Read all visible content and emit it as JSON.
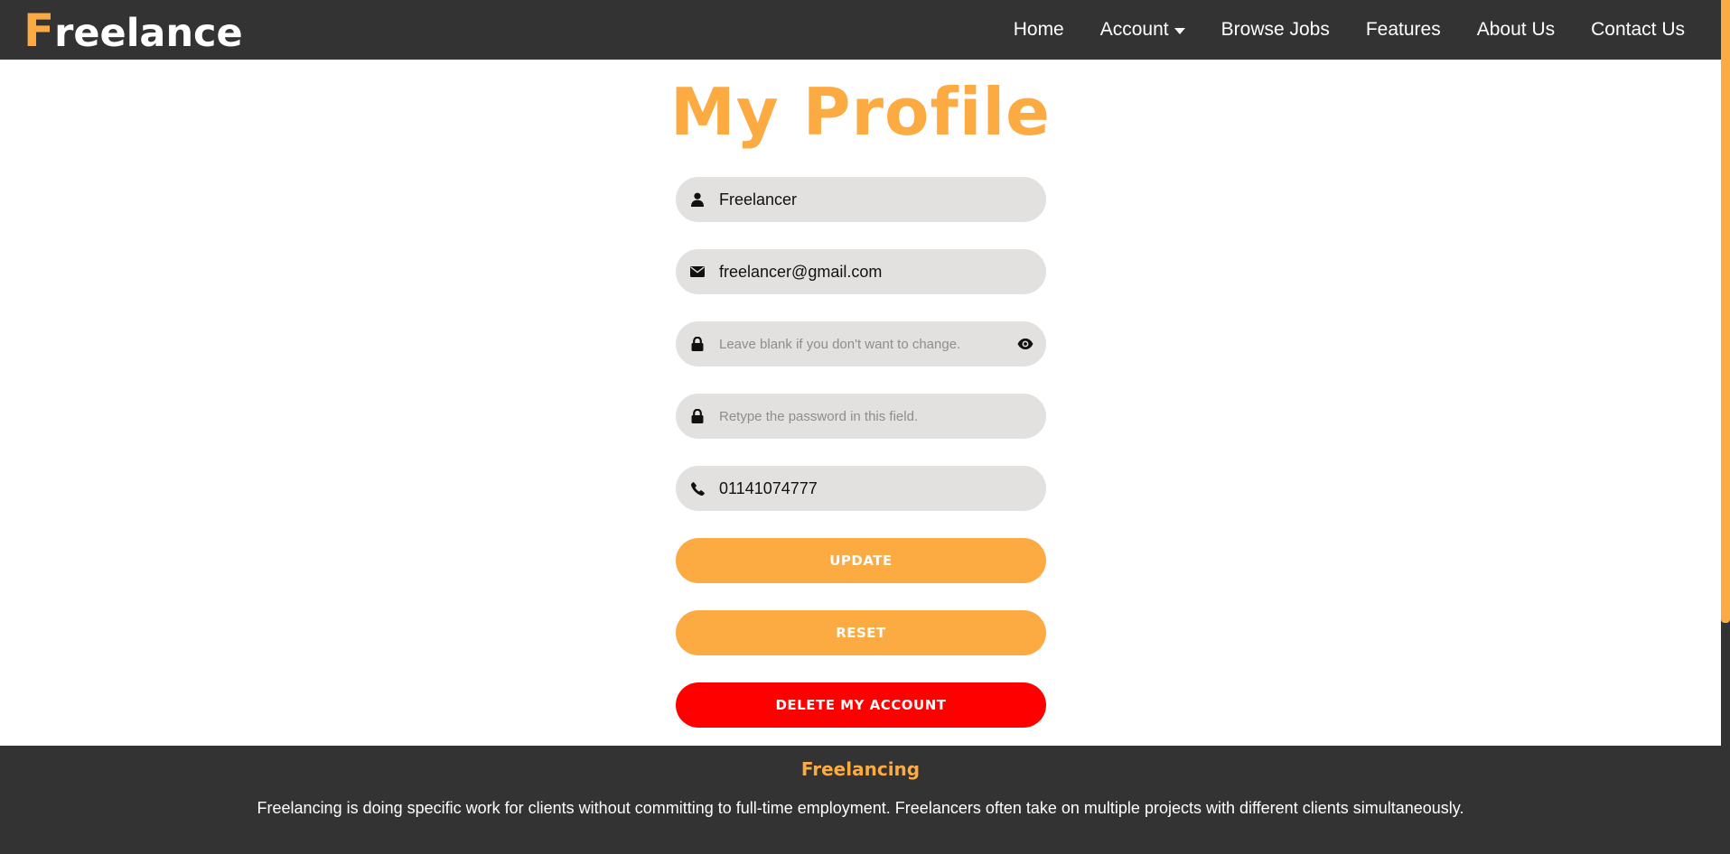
{
  "brand": {
    "first_letter": "F",
    "rest": "reelance",
    "accent_color": "#fcaa42"
  },
  "nav": {
    "items": [
      {
        "label": "Home"
      },
      {
        "label": "Account"
      },
      {
        "label": "Browse Jobs"
      },
      {
        "label": "Features"
      },
      {
        "label": "About Us"
      },
      {
        "label": "Contact Us"
      }
    ]
  },
  "page": {
    "title": "My Profile"
  },
  "form": {
    "username": {
      "value": "Freelancer",
      "icon": "user-icon"
    },
    "email": {
      "value": "freelancer@gmail.com",
      "icon": "envelope-icon"
    },
    "password": {
      "value": "",
      "placeholder": "Leave blank if you don't want to change.",
      "icon": "lock-icon"
    },
    "confirm_password": {
      "value": "",
      "placeholder": "Retype the password in this field.",
      "icon": "lock-icon"
    },
    "phone": {
      "value": "01141074777",
      "icon": "phone-icon"
    },
    "update_label": "UPDATE",
    "reset_label": "RESET",
    "delete_label": "DELETE MY ACCOUNT"
  },
  "footer": {
    "title": "Freelancing",
    "text": "Freelancing is doing specific work for clients without committing to full-time employment. Freelancers often take on multiple projects with different clients simultaneously."
  },
  "colors": {
    "accent": "#fcaa42",
    "danger": "#ff0000",
    "dark": "#333333",
    "field_bg": "#e3e0e0"
  }
}
